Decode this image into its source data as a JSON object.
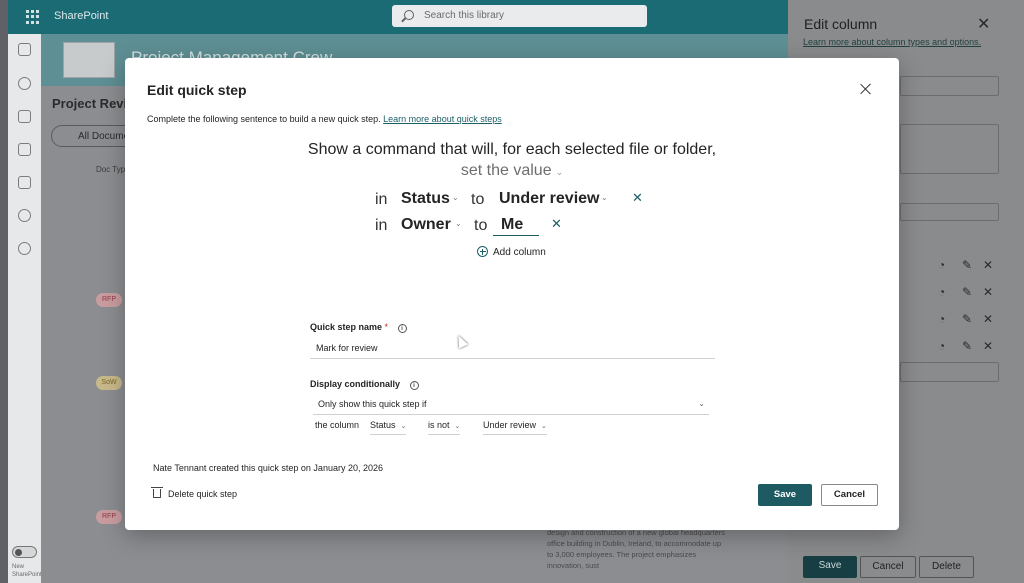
{
  "app": {
    "suite_name": "SharePoint",
    "search_placeholder": "Search this library",
    "site_title": "Project Management Crew",
    "page_heading": "Project Revi",
    "view_pill": "All Docume",
    "column_header": "Doc Typ",
    "tags": [
      "RFP",
      "SoW",
      "RFP"
    ],
    "row_description": "design and construction of a new global headquarters office building in Dublin, Ireland, to accommodate up to 3,000 employees. The project emphasizes innovation, sust",
    "toggle_label": "New SharePoint"
  },
  "right_panel": {
    "title": "Edit column",
    "link": "Learn more about column types and options.",
    "save_label": "Save",
    "cancel_label": "Cancel",
    "delete_label": "Delete"
  },
  "dialog": {
    "title": "Edit quick step",
    "intro_text": "Complete the following sentence to build a new quick step.",
    "intro_link": "Learn more about quick steps",
    "sentence": "Show a command that will, for each selected file or folder,",
    "action": "set the value",
    "word_in": "in",
    "word_to": "to",
    "assignments": [
      {
        "column": "Status",
        "value": "Under review"
      },
      {
        "column": "Owner",
        "value": "Me"
      }
    ],
    "add_column_label": "Add column",
    "name_label": "Quick step name",
    "name_required_mark": "*",
    "name_value": "Mark for review",
    "display_label": "Display conditionally",
    "display_option": "Only show this quick step if",
    "condition": {
      "prefix": "the column",
      "column": "Status",
      "operator": "is not",
      "value": "Under review"
    },
    "created_info": "Nate Tennant created this quick step on January 20, 2026",
    "delete_label": "Delete quick step",
    "save_label": "Save",
    "cancel_label": "Cancel"
  },
  "colors": {
    "accent": "#1b5f66",
    "primary_button": "#1e5a62",
    "suite_bar": "#1b6b75",
    "required": "#c42b1c"
  }
}
